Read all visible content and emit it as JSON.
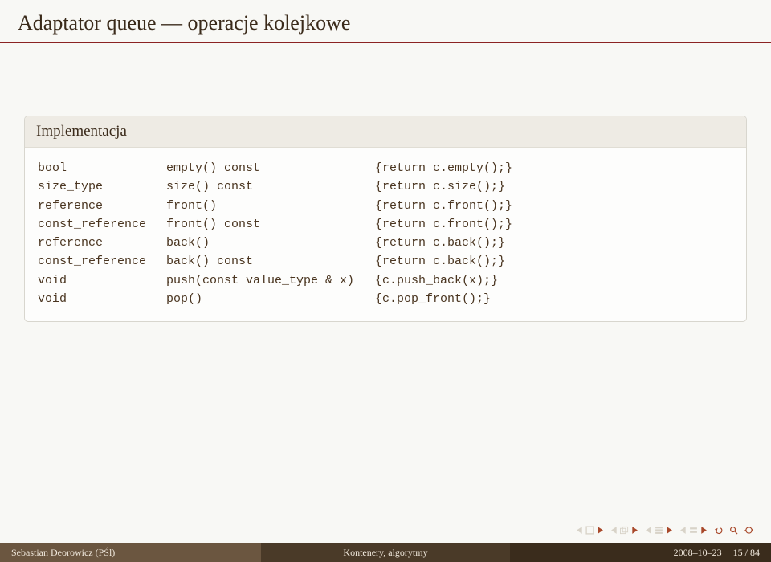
{
  "title": "Adaptator queue — operacje kolejkowe",
  "block": {
    "heading": "Implementacja",
    "rows": [
      {
        "ret": "bool",
        "sig": "empty() const",
        "body": "{return c.empty();}"
      },
      {
        "ret": "size_type",
        "sig": "size() const",
        "body": "{return c.size();}"
      },
      {
        "ret": "reference",
        "sig": "front()",
        "body": "{return c.front();}"
      },
      {
        "ret": "const_reference",
        "sig": "front() const",
        "body": "{return c.front();}"
      },
      {
        "ret": "reference",
        "sig": "back()",
        "body": "{return c.back();}"
      },
      {
        "ret": "const_reference",
        "sig": "back() const",
        "body": "{return c.back();}"
      },
      {
        "ret": "void",
        "sig": "push(const value_type & x)",
        "body": "{c.push_back(x);}"
      },
      {
        "ret": "void",
        "sig": "pop()",
        "body": "{c.pop_front();}"
      }
    ]
  },
  "footer": {
    "author": "Sebastian Deorowicz (PŚl)",
    "center": "Kontenery, algorytmy",
    "date": "2008–10–23",
    "page": "15 / 84"
  },
  "nav": {
    "dull": "#d8d3c8",
    "accent": "#a8482a"
  }
}
